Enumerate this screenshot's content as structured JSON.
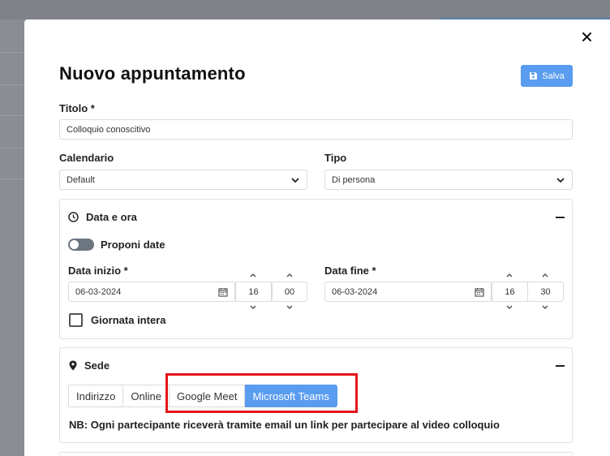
{
  "modal": {
    "title": "Nuovo appuntamento",
    "save_label": "Salva",
    "close_icon": "close-icon"
  },
  "form": {
    "titolo_label": "Titolo *",
    "titolo_value": "Colloquio conoscitivo",
    "calendario_label": "Calendario",
    "calendario_value": "Default",
    "tipo_label": "Tipo",
    "tipo_value": "Di persona"
  },
  "data_ora": {
    "title": "Data e ora",
    "proponi_label": "Proponi date",
    "proponi_on": false,
    "inizio_label": "Data inizio *",
    "inizio_date": "06-03-2024",
    "inizio_hour": "16",
    "inizio_min": "00",
    "fine_label": "Data fine *",
    "fine_date": "06-03-2024",
    "fine_hour": "16",
    "fine_min": "30",
    "giornata_label": "Giornata intera",
    "giornata_checked": false
  },
  "sede": {
    "title": "Sede",
    "options": [
      "Indirizzo",
      "Online",
      "Google Meet",
      "Microsoft Teams"
    ],
    "selected": "Microsoft Teams",
    "note": "NB: Ogni partecipante riceverà tramite email un link per partecipare al video colloquio"
  },
  "colors": {
    "accent": "#5a9cf0",
    "highlight": "#e5141a"
  }
}
